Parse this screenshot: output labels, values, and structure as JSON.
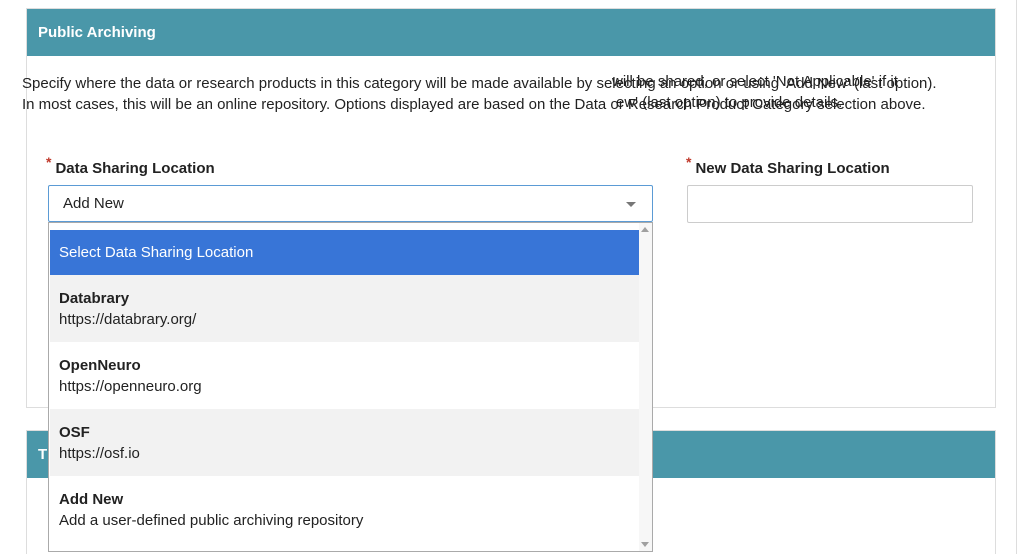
{
  "section1": {
    "title": "Public Archiving",
    "description": "Specify where the data or research products in this category will be made available by selecting an option or using 'Add New' (last option). In most cases, this will be an online repository. Options displayed are based on the Data or Research Product Category selection above.",
    "required_mark": "*",
    "location_label": "Data Sharing Location",
    "location_value": "Add New",
    "new_location_label": "New Data Sharing Location",
    "new_location_value": ""
  },
  "dropdown": {
    "selected_label": "Select Data Sharing Location",
    "options": [
      {
        "title": "Databrary",
        "subtitle": "https://databrary.org/"
      },
      {
        "title": "OpenNeuro",
        "subtitle": "https://openneuro.org"
      },
      {
        "title": "OSF",
        "subtitle": "https://osf.io"
      },
      {
        "title": "Add New",
        "subtitle": "Add a user-defined public archiving repository"
      }
    ]
  },
  "section2": {
    "title_partial": "T",
    "text_line1": "will be shared, or select 'Not Applicable' if it",
    "text_line2": "ew' (last option) to provide details."
  },
  "icons": {
    "select_caret": "chevron-down-icon",
    "scroll_up": "arrow-up-icon",
    "scroll_down": "arrow-down-icon"
  },
  "colors": {
    "header_bg": "#4a97a9",
    "selected_option_bg": "#3875d7",
    "required_star": "#c0392b"
  }
}
